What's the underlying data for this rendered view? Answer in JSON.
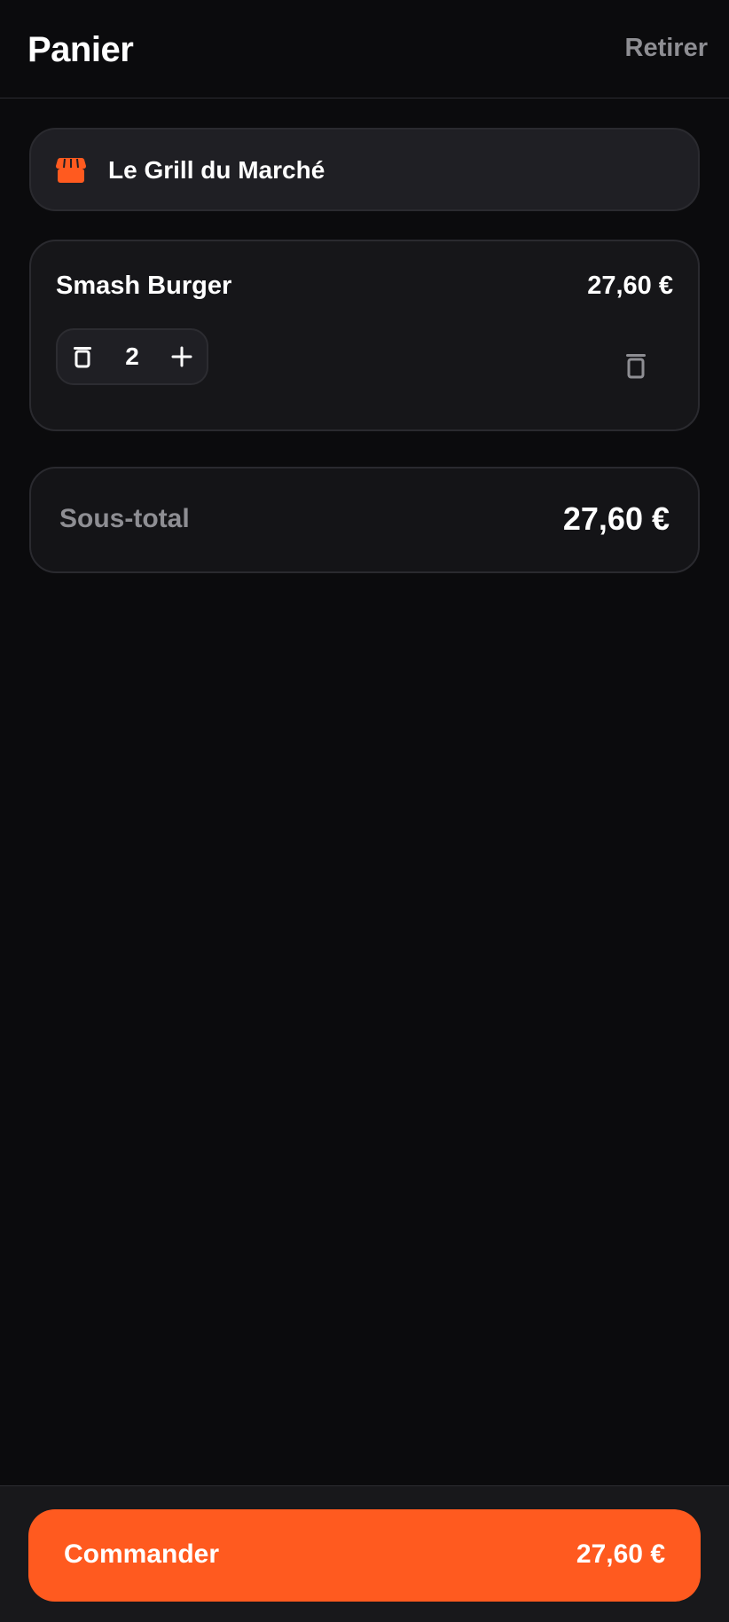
{
  "header": {
    "title": "Panier",
    "action_label": "Retirer"
  },
  "restaurant": {
    "icon": "storefront-icon",
    "name": "Le Grill du Marché"
  },
  "cart": {
    "items": [
      {
        "name": "Smash Burger",
        "price": "27,60 €",
        "quantity": "2",
        "decrement_icon": "trash-icon",
        "increment_icon": "plus-icon",
        "delete_icon": "trash-icon"
      }
    ]
  },
  "summary": {
    "subtotal_label": "Sous-total",
    "subtotal_value": "27,60 €"
  },
  "footer": {
    "order_label": "Commander",
    "order_total": "27,60 €"
  },
  "colors": {
    "accent": "#ff5a1f",
    "background": "#0b0b0d",
    "muted_text": "#8e8e93"
  }
}
